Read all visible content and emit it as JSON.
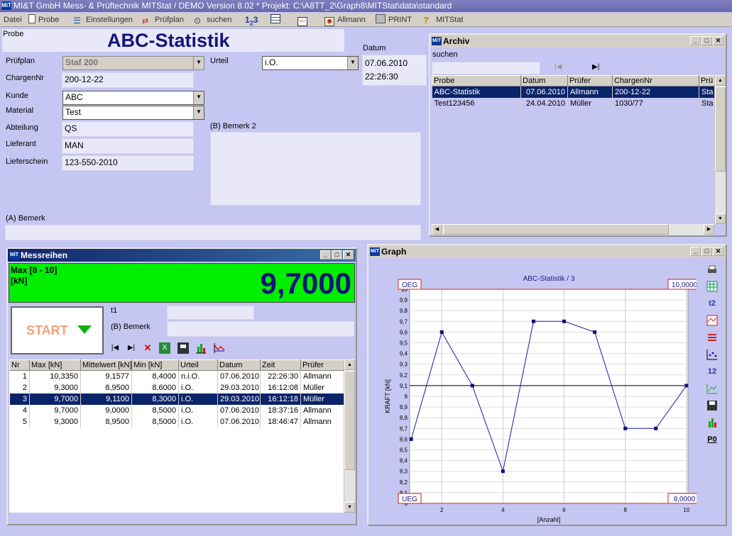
{
  "app": {
    "title": "MI&T GmbH Mess- & Prüftechnik MITStat / DEMO  Version 8.02 * Projekt: C:\\A8TT_2\\Graph8\\MITStat\\data\\standard",
    "logo_text": "MiT"
  },
  "menu": {
    "datei": "Datei",
    "probe": "Probe",
    "einstellungen": "Einstellungen",
    "pruefplan": "Prüfplan",
    "suchen": "suchen",
    "allmann": "Allmann",
    "print": "PRINT",
    "mitstat": "MITStat"
  },
  "form": {
    "probe_label": "Probe",
    "heading": "ABC-Statistik",
    "pruefplan_label": "Prüfplan",
    "pruefplan_value": "Staf 200",
    "chargennr_label": "ChargenNr",
    "chargennr_value": "200-12-22",
    "kunde_label": "Kunde",
    "kunde_value": "ABC",
    "material_label": "Material",
    "material_value": "Test",
    "abteilung_label": "Abteilung",
    "abteilung_value": "QS",
    "lieferant_label": "Lieferant",
    "lieferant_value": "MAN",
    "lieferschein_label": "Lieferschein",
    "lieferschein_value": "123-550-2010",
    "urteil_label": "Urteil",
    "urteil_value": "i.O.",
    "datum_label": "Datum",
    "datum_value": "07.06.2010",
    "zeit_value": "22:26:30",
    "bemerk2_label": "(B)   Bemerk 2",
    "bemerk_a_label": "(A) Bemerk"
  },
  "archiv": {
    "title": "Archiv",
    "search_label": "suchen",
    "search_value": "",
    "columns": [
      "Probe",
      "Datum",
      "Prüfer",
      "ChargenNr",
      "Prü"
    ],
    "rows": [
      [
        "ABC-Statistik",
        "07.06.2010",
        "Allmann",
        "200-12-22",
        "Sta"
      ],
      [
        "Test123456",
        "24.04.2010",
        "Müller",
        "1030/77",
        "Sta"
      ]
    ],
    "selected_row": 0
  },
  "messreihen": {
    "title": "Messreihen",
    "measure_label": "Max [8 - 10]",
    "unit_label": "[kN]",
    "big_value": "9,7000",
    "start_label": "START",
    "t1_label": "t1",
    "bemerk_label": "(B) Bemerk",
    "columns": [
      "Nr",
      "Max [kN]",
      "Mittelwert [kN]",
      "Min [kN]",
      "Urteil",
      "Datum",
      "Zeit",
      "Prüfer"
    ],
    "rows": [
      [
        "1",
        "10,3350",
        "9,1577",
        "8,4000",
        "n.i.O.",
        "07.06.2010",
        "22:26:30",
        "Allmann"
      ],
      [
        "2",
        "9,3000",
        "8,9500",
        "8,6000",
        "i.O.",
        "29.03.2010",
        "16:12:08",
        "Müller"
      ],
      [
        "3",
        "9,7000",
        "9,1100",
        "8,3000",
        "i.O.",
        "29.03.2010",
        "16:12:18",
        "Müller"
      ],
      [
        "4",
        "9,7000",
        "9,0000",
        "8,5000",
        "i.O.",
        "07.06.2010",
        "18:37:16",
        "Allmann"
      ],
      [
        "5",
        "9,3000",
        "8,9500",
        "8,5000",
        "i.O.",
        "07.06.2010",
        "18:46:47",
        "Allmann"
      ]
    ],
    "selected_row": 2
  },
  "graph": {
    "title": "Graph",
    "oeg_label": "OEG",
    "ueg_label": "UEG",
    "oeg_value": "10,0000",
    "ueg_value": "8,0000"
  },
  "chart_data": {
    "type": "line",
    "title": "ABC-Statistik / 3",
    "xlabel": "[Anzahl]",
    "ylabel": "KRAFT [kN]",
    "x": [
      1,
      2,
      3,
      4,
      5,
      6,
      7,
      8,
      9,
      10
    ],
    "series": [
      {
        "values": [
          8.6,
          9.6,
          9.1,
          8.3,
          9.7,
          9.7,
          9.6,
          8.7,
          8.7,
          9.1
        ]
      }
    ],
    "mean_line": 9.1,
    "upper_limit": 10.0,
    "lower_limit": 8.0,
    "xlim": [
      0.95,
      10.05
    ],
    "ylim": [
      8.0,
      10.0
    ],
    "x_ticks": [
      "2",
      "4",
      "6",
      "8",
      "10"
    ],
    "y_ticks": [
      "8",
      "8,1",
      "8,2",
      "8,3",
      "8,4",
      "8,5",
      "8,6",
      "8,7",
      "8,8",
      "8,9",
      "9",
      "9,1",
      "9,2",
      "9,3",
      "9,4",
      "9,5",
      "9,6",
      "9,7",
      "9,8",
      "9,9",
      "10"
    ],
    "grid": true,
    "colors": {
      "line": "#1a1aa8",
      "limits": "#dd2222",
      "mean": "#000000"
    }
  }
}
